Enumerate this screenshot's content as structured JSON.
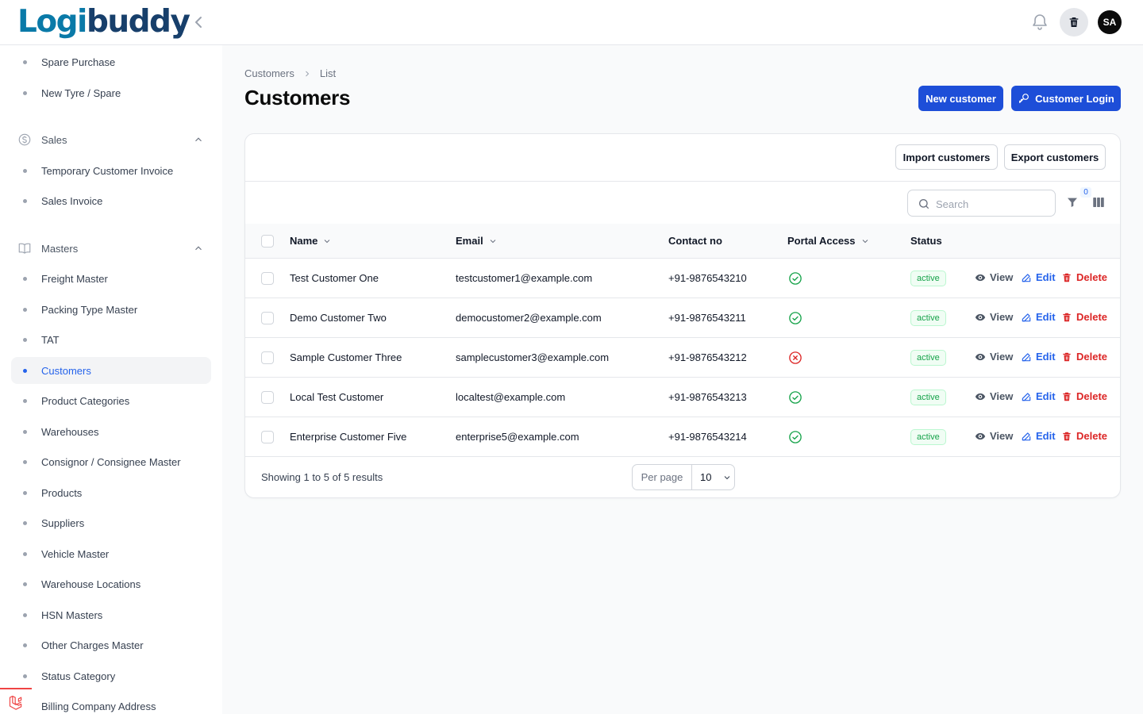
{
  "app": {
    "logo_part1": "Logi",
    "logo_part2": "buddy",
    "avatar_initials": "SA"
  },
  "sidebar": {
    "items_top": [
      {
        "label": "Spare Purchase"
      },
      {
        "label": "New Tyre / Spare"
      }
    ],
    "groups": [
      {
        "label": "Sales",
        "icon": "currency-icon",
        "items": [
          "Temporary Customer Invoice",
          "Sales Invoice"
        ]
      },
      {
        "label": "Masters",
        "icon": "book-icon",
        "items": [
          "Freight Master",
          "Packing Type Master",
          "TAT",
          "Customers",
          "Product Categories",
          "Warehouses",
          "Consignor / Consignee Master",
          "Products",
          "Suppliers",
          "Vehicle Master",
          "Warehouse Locations",
          "HSN Masters",
          "Other Charges Master",
          "Status Category",
          "Billing Company Address"
        ]
      }
    ],
    "active": "Customers"
  },
  "breadcrumb": {
    "root": "Customers",
    "current": "List"
  },
  "page": {
    "title": "Customers",
    "new_button": "New customer",
    "login_button": "Customer Login"
  },
  "toolbar": {
    "import_button": "Import customers",
    "export_button": "Export customers",
    "search_placeholder": "Search",
    "filter_count": "0"
  },
  "table": {
    "headers": {
      "name": "Name",
      "email": "Email",
      "contact": "Contact no",
      "portal": "Portal Access",
      "status": "Status"
    },
    "action_labels": {
      "view": "View",
      "edit": "Edit",
      "delete": "Delete"
    },
    "rows": [
      {
        "name": "Test Customer One",
        "email": "testcustomer1@example.com",
        "contact": "+91-9876543210",
        "portal": true,
        "status": "active"
      },
      {
        "name": "Demo Customer Two",
        "email": "democustomer2@example.com",
        "contact": "+91-9876543211",
        "portal": true,
        "status": "active"
      },
      {
        "name": "Sample Customer Three",
        "email": "samplecustomer3@example.com",
        "contact": "+91-9876543212",
        "portal": false,
        "status": "active"
      },
      {
        "name": "Local Test Customer",
        "email": "localtest@example.com",
        "contact": "+91-9876543213",
        "portal": true,
        "status": "active"
      },
      {
        "name": "Enterprise Customer Five",
        "email": "enterprise5@example.com",
        "contact": "+91-9876543214",
        "portal": true,
        "status": "active"
      }
    ]
  },
  "pagination": {
    "summary": "Showing 1 to 5 of 5 results",
    "per_page_label": "Per page",
    "per_page_value": "10"
  },
  "colors": {
    "primary": "#1d4ed8",
    "active_nav": "#2563eb",
    "success": "#16a34a",
    "danger": "#dc2626"
  }
}
